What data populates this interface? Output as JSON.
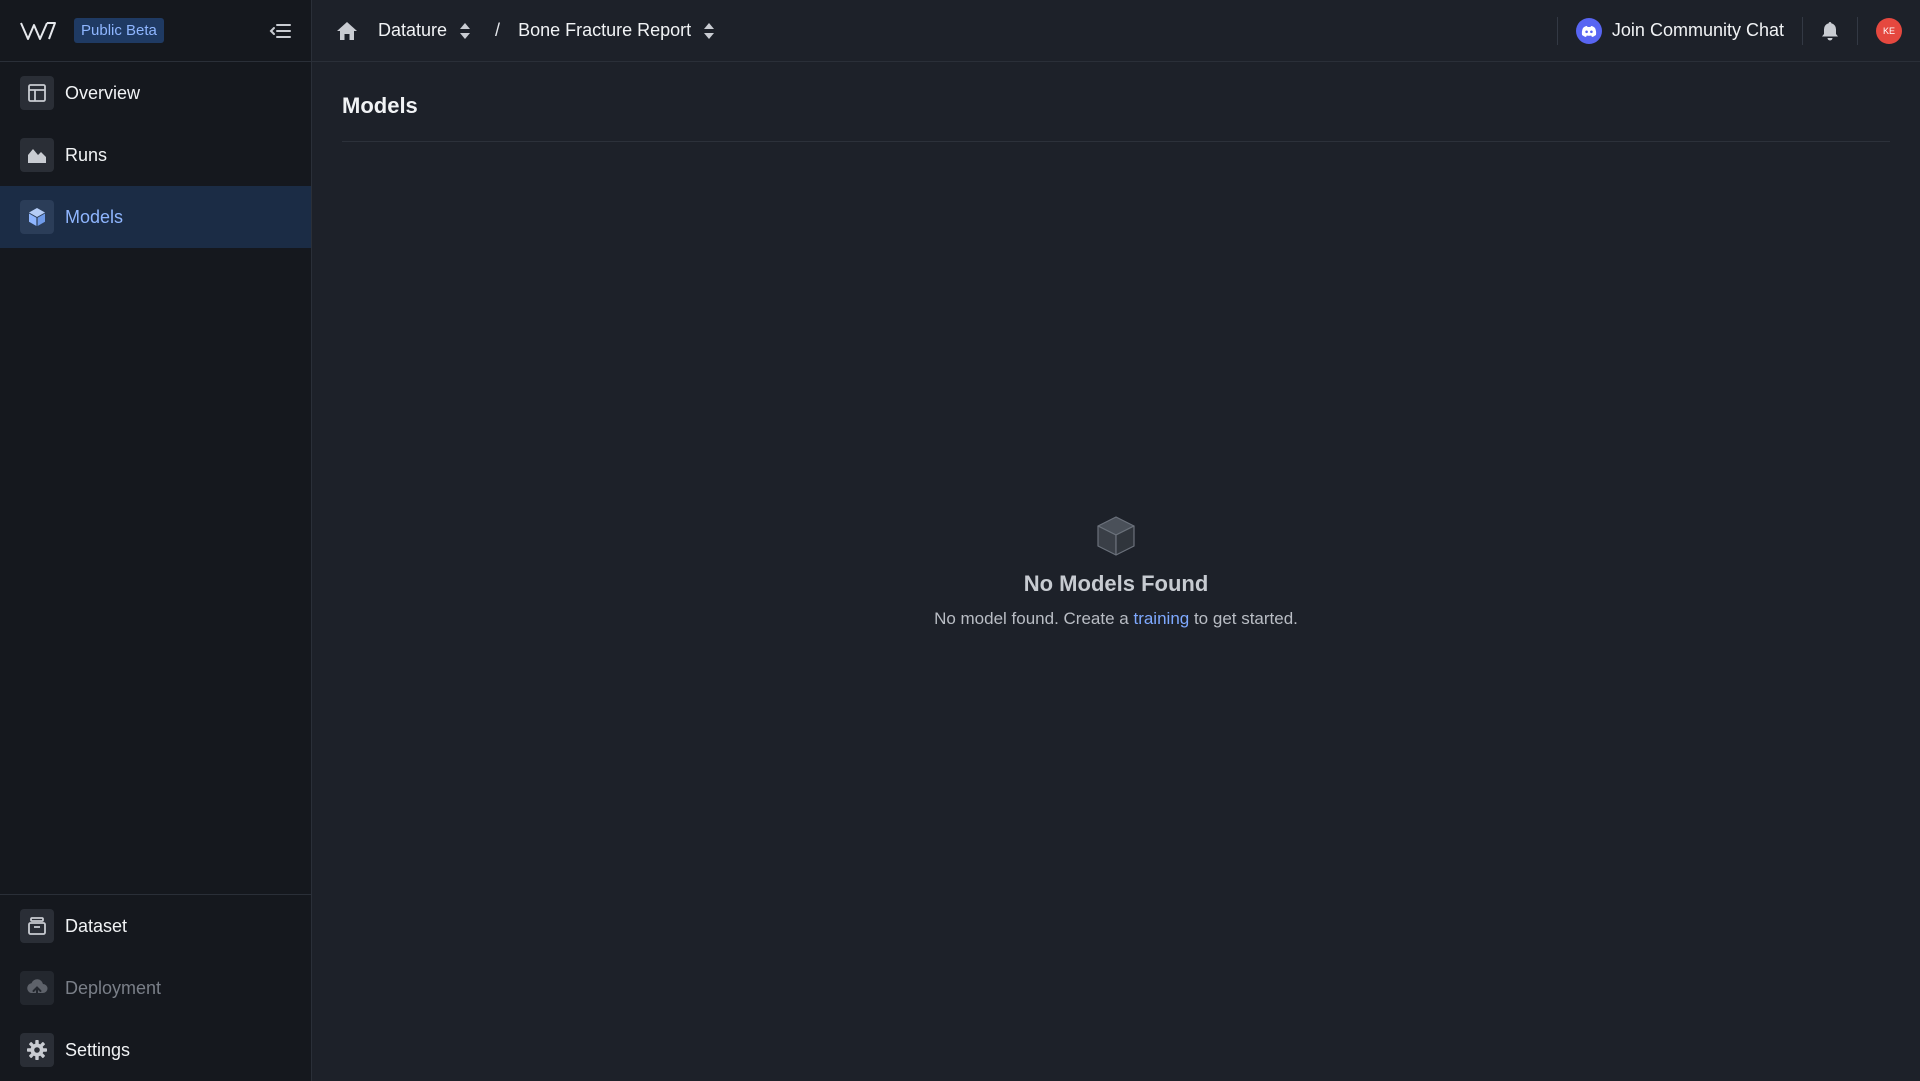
{
  "sidebar": {
    "badge": "Public Beta",
    "items": [
      {
        "label": "Overview",
        "icon": "layout-icon"
      },
      {
        "label": "Runs",
        "icon": "area-chart-icon"
      },
      {
        "label": "Models",
        "icon": "cube-icon",
        "active": true
      }
    ],
    "bottom_items": [
      {
        "label": "Dataset",
        "icon": "archive-icon"
      },
      {
        "label": "Deployment",
        "icon": "cloud-upload-icon",
        "disabled": true
      },
      {
        "label": "Settings",
        "icon": "gear-icon"
      }
    ]
  },
  "topbar": {
    "workspace": "Datature",
    "separator": "/",
    "project": "Bone Fracture Report",
    "community_label": "Join Community Chat",
    "avatar_initials": "KE"
  },
  "main": {
    "title": "Models",
    "empty_title": "No Models Found",
    "empty_text_before": "No model found. Create a ",
    "empty_link": "training",
    "empty_text_after": " to get started."
  },
  "colors": {
    "accent": "#8fb6ff",
    "active_bg": "#1b2c45",
    "avatar": "#e5483f",
    "discord": "#5865f2"
  }
}
